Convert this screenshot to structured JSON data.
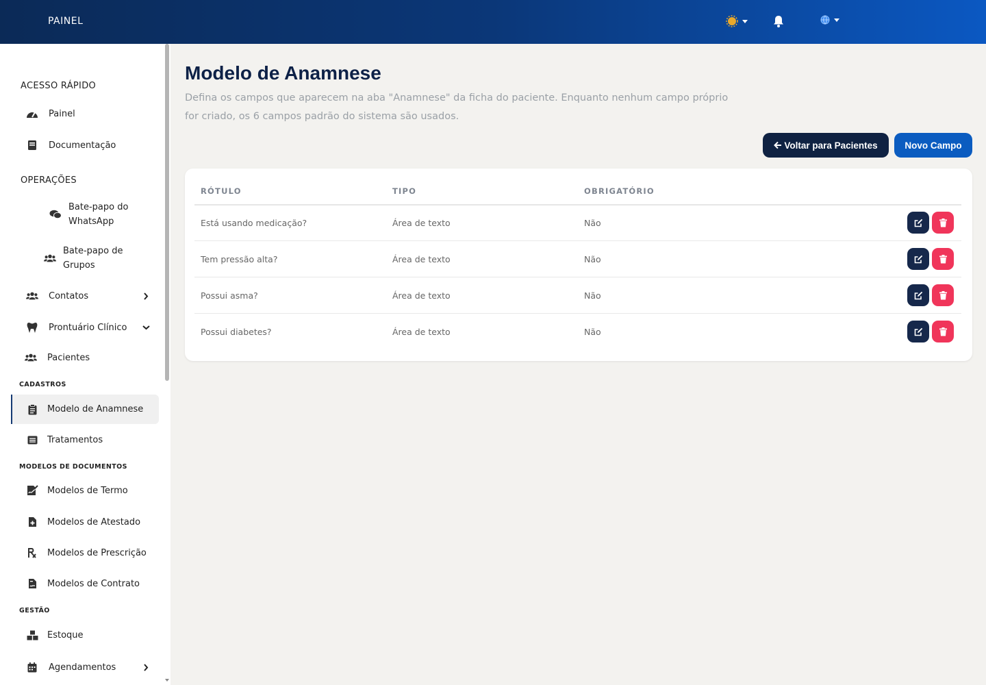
{
  "topbar": {
    "brand": "PAINEL"
  },
  "sidebar": {
    "quick_access_title": "ACESSO RÁPIDO",
    "quick_items": [
      {
        "label": "Painel",
        "icon": "dashboard-icon"
      },
      {
        "label": "Documentação",
        "icon": "book-icon"
      }
    ],
    "operations_title": "OPERAÇÕES",
    "ops_items": [
      {
        "label": "Bate-papo do\nWhatsApp",
        "icon": "comments-icon"
      },
      {
        "label": "Bate-papo de\nGrupos",
        "icon": "users-icon"
      },
      {
        "label": "Contatos",
        "icon": "users-icon",
        "chevron": "right"
      },
      {
        "label": "Prontuário Clínico",
        "icon": "tooth-icon",
        "chevron": "down"
      },
      {
        "label": "Pacientes",
        "icon": "users-icon"
      }
    ],
    "cadastros_title": "CADASTROS",
    "cadastros_items": [
      {
        "label": "Modelo de Anamnese",
        "icon": "clipboard-icon",
        "active": true
      },
      {
        "label": "Tratamentos",
        "icon": "list-icon"
      }
    ],
    "doc_models_title": "MODELOS DE DOCUMENTOS",
    "doc_items": [
      {
        "label": "Modelos de Termo",
        "icon": "signature-icon"
      },
      {
        "label": "Modelos de Atestado",
        "icon": "file-medical-icon"
      },
      {
        "label": "Modelos de Prescrição",
        "icon": "prescription-icon"
      },
      {
        "label": "Modelos de Contrato",
        "icon": "file-contract-icon"
      }
    ],
    "gestao_title": "GESTÃO",
    "gestao_items": [
      {
        "label": "Estoque",
        "icon": "boxes-icon"
      },
      {
        "label": "Agendamentos",
        "icon": "calendar-icon",
        "chevron": "right"
      }
    ]
  },
  "main": {
    "title": "Modelo de Anamnese",
    "description": "Defina os campos que aparecem na aba \"Anamnese\" da ficha do paciente. Enquanto nenhum campo próprio for criado, os 6 campos padrão do sistema são usados.",
    "back_button": "Voltar para Pacientes",
    "new_button": "Novo Campo",
    "table": {
      "headers": [
        "RÓTULO",
        "TIPO",
        "OBRIGATÓRIO"
      ],
      "rows": [
        {
          "label": "Está usando medicação?",
          "type": "Área de texto",
          "required": "Não"
        },
        {
          "label": "Tem pressão alta?",
          "type": "Área de texto",
          "required": "Não"
        },
        {
          "label": "Possui asma?",
          "type": "Área de texto",
          "required": "Não"
        },
        {
          "label": "Possui diabetes?",
          "type": "Área de texto",
          "required": "Não"
        }
      ]
    }
  },
  "colors": {
    "accent": "#0b5cc0",
    "dark": "#0f2242",
    "danger": "#f0355a"
  }
}
